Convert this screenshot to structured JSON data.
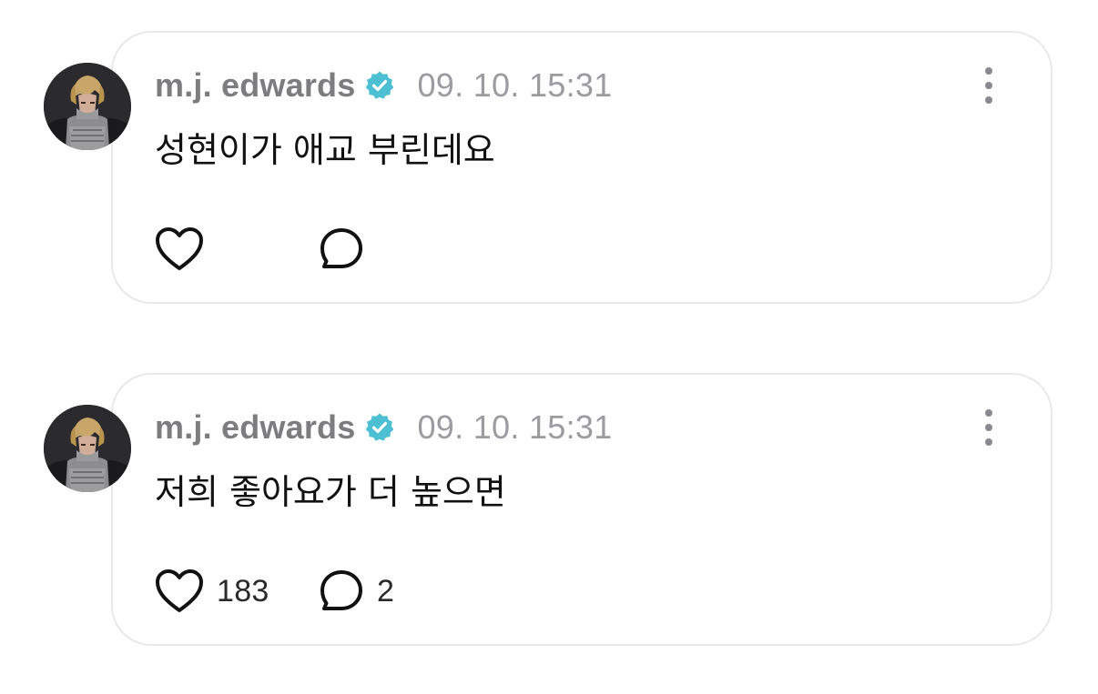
{
  "posts": [
    {
      "username": "m.j. edwards",
      "timestamp": "09. 10. 15:31",
      "text": "성현이가 애교 부린데요",
      "likes": "",
      "replies": ""
    },
    {
      "username": "m.j. edwards",
      "timestamp": "09. 10. 15:31",
      "text": "저희 좋아요가 더 높으면",
      "likes": "183",
      "replies": "2"
    }
  ],
  "icons": {
    "verified": "verified-badge-icon",
    "more": "more-vertical-icon",
    "like": "heart-outline-icon",
    "reply": "speech-bubble-icon"
  },
  "colors": {
    "verified_badge": "#4cc0d2",
    "card_border": "#e9e9ec",
    "username": "#7d7d80",
    "timestamp": "#9b9ba0",
    "body_text": "#111111",
    "icon": "#111111"
  }
}
